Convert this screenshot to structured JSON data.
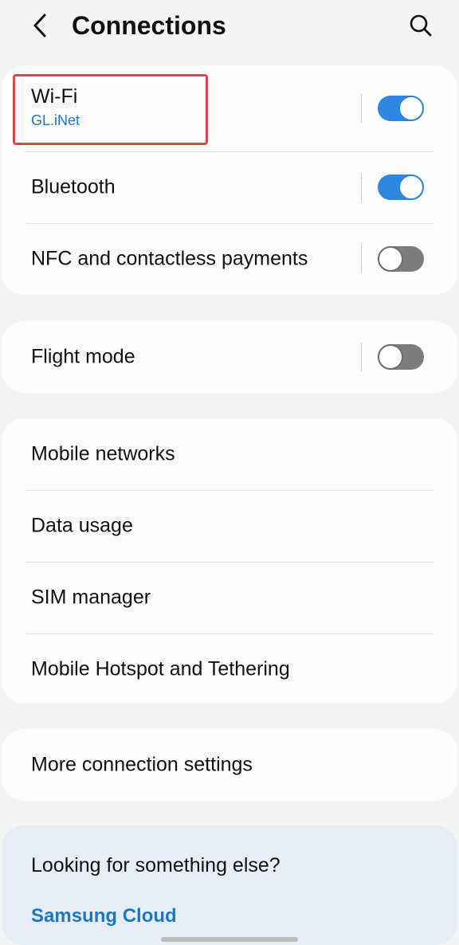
{
  "header": {
    "title": "Connections",
    "back_icon": "chevron-left-icon",
    "search_icon": "search-icon"
  },
  "groups": [
    {
      "items": [
        {
          "label": "Wi-Fi",
          "sublabel": "GL.iNet",
          "toggle": true,
          "state": "on"
        },
        {
          "label": "Bluetooth",
          "toggle": true,
          "state": "on"
        },
        {
          "label": "NFC and contactless payments",
          "toggle": true,
          "state": "off"
        }
      ]
    },
    {
      "items": [
        {
          "label": "Flight mode",
          "toggle": true,
          "state": "off"
        }
      ]
    },
    {
      "items": [
        {
          "label": "Mobile networks"
        },
        {
          "label": "Data usage"
        },
        {
          "label": "SIM manager"
        },
        {
          "label": "Mobile Hotspot and Tethering"
        }
      ]
    },
    {
      "items": [
        {
          "label": "More connection settings"
        }
      ]
    }
  ],
  "suggestions": {
    "title": "Looking for something else?",
    "link": "Samsung Cloud"
  },
  "colors": {
    "accent": "#2f86e0",
    "link": "#1b78c8",
    "highlight": "#d44a4a"
  }
}
